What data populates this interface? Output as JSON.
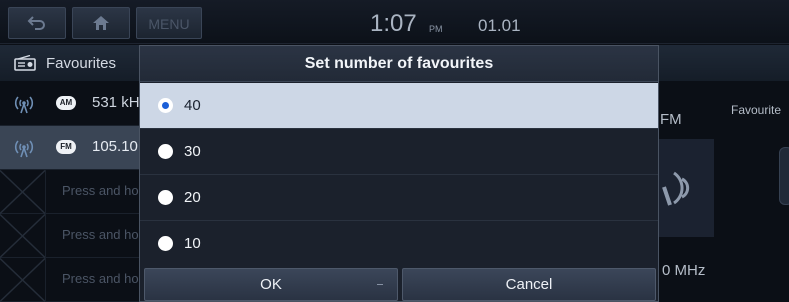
{
  "status_bar": {
    "time": "1:07",
    "ampm": "PM",
    "date": "01.01",
    "menu_label": "MENU"
  },
  "title_bar": {
    "title": "Favourites"
  },
  "background_list": [
    {
      "band": "AM",
      "frequency": "531 kHz"
    },
    {
      "band": "FM",
      "frequency": "105.10"
    },
    {
      "placeholder": "Press and hold"
    },
    {
      "placeholder": "Press and hold"
    },
    {
      "placeholder": "Press and hold"
    }
  ],
  "background_panel": {
    "band_label": "FM",
    "favourite_label": "Favourite",
    "frequency": "0 MHz"
  },
  "dialog": {
    "title": "Set number of favourites",
    "options": [
      {
        "label": "40",
        "selected": true
      },
      {
        "label": "30",
        "selected": false
      },
      {
        "label": "20",
        "selected": false
      },
      {
        "label": "10",
        "selected": false
      }
    ],
    "ok_label": "OK",
    "cancel_label": "Cancel"
  },
  "colors": {
    "selected_row": "#cdd7e6",
    "radio_dot": "#1b5fd8",
    "dialog_bg": "#1b212c"
  }
}
